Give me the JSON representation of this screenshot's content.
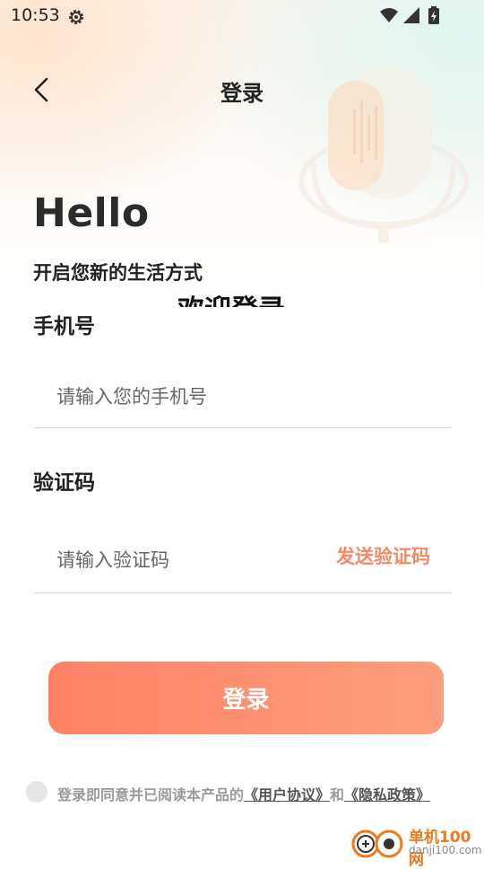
{
  "status_bar": {
    "time": "10:53",
    "settings_icon": "gear-icon",
    "wifi_icon": "wifi-icon",
    "signal_icon": "signal-icon",
    "battery_icon": "battery-charging-icon"
  },
  "header": {
    "back_icon": "chevron-left-icon",
    "title": "登录"
  },
  "hero": {
    "hello": "Hello",
    "subtitle": "开启您新的生活方式",
    "welcome": "欢迎登录"
  },
  "form": {
    "phone_label": "手机号",
    "phone_placeholder": "请输入您的手机号",
    "phone_value": "",
    "code_label": "验证码",
    "code_placeholder": "请输入验证码",
    "code_value": "",
    "send_code": "发送验证码"
  },
  "login_button": "登录",
  "agreement": {
    "prefix": "登录即同意并已阅读本产品的",
    "user_agreement": "《用户协议》",
    "and": "和",
    "privacy_policy": "《隐私政策》",
    "checked": false
  },
  "watermark": {
    "cn": "单机100网",
    "en": "danji100.com"
  },
  "colors": {
    "accent": "#f58964",
    "button_start": "#fd8264",
    "button_end": "#fd9d7c"
  }
}
